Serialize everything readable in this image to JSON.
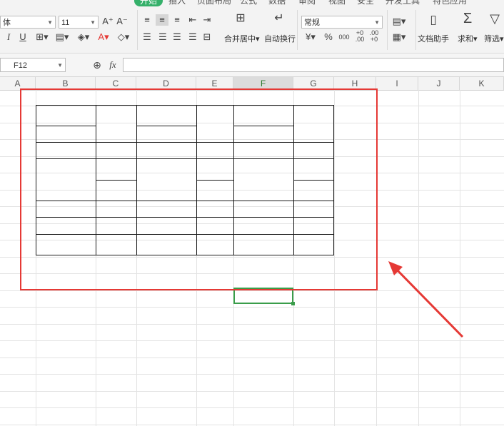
{
  "menubar": {
    "items": [
      "开始",
      "插入",
      "页面布局",
      "公式",
      "数据",
      "审阅",
      "视图",
      "安全",
      "开发工具",
      "特色应用"
    ],
    "active_index": 0
  },
  "ribbon": {
    "font_name": "体",
    "font_size": "11",
    "grow_font": "A⁺",
    "shrink_font": "A⁻",
    "italic": "I",
    "underline": "U",
    "font_color_letter": "A",
    "merge_center_label": "合并居中",
    "wrap_text_label": "自动换行",
    "number_format": "常规",
    "currency_symbol": "¥",
    "percent_symbol": "%",
    "thousands_symbol": "000",
    "inc_decimal": "+0 .00",
    "dec_decimal": ".00 +0",
    "doc_assistant_label": "文档助手",
    "sum_symbol": "Σ",
    "sum_label": "求和",
    "filter_label": "筛选"
  },
  "formulabar": {
    "cell_ref": "F12",
    "fx_label": "fx",
    "formula": ""
  },
  "columns": [
    "A",
    "B",
    "C",
    "D",
    "E",
    "F",
    "G",
    "H",
    "I",
    "J",
    "K"
  ],
  "selected_column": "F",
  "selected_cell": "F12",
  "colors": {
    "accent_green": "#35b06a",
    "selection_green": "#3a9d4a",
    "annotation_red": "#e53935",
    "table_border": "#1a1a1a"
  }
}
